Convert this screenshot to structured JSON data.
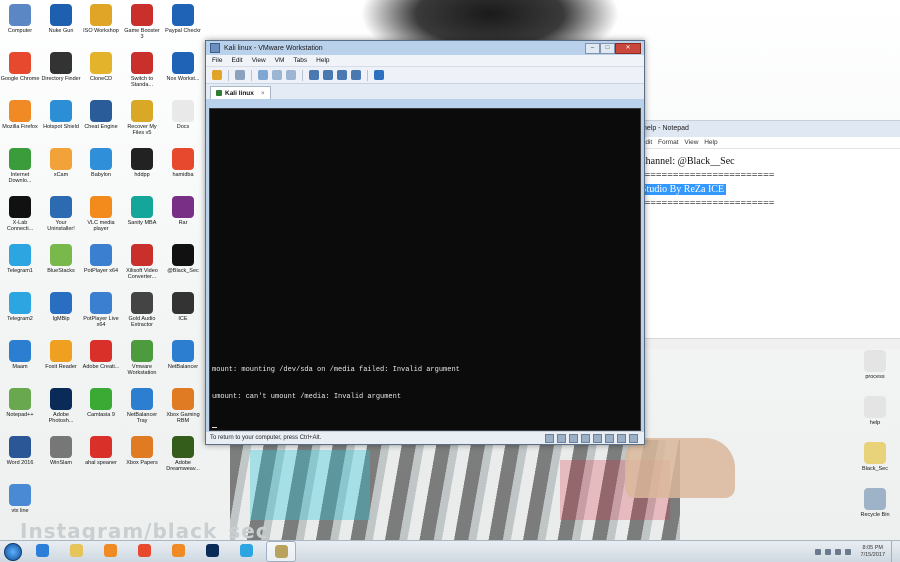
{
  "desktop": {
    "icons": [
      {
        "label": "Computer",
        "color": "#5b87c4"
      },
      {
        "label": "Nuke Gun",
        "color": "#1f5fb0"
      },
      {
        "label": "ISO Workshop",
        "color": "#e0a526"
      },
      {
        "label": "Game Booster 3",
        "color": "#c9302c"
      },
      {
        "label": "Paypal Checkr",
        "color": "#1e63b6"
      },
      {
        "label": "Google Chrome",
        "color": "#e7492f"
      },
      {
        "label": "Directory Finder",
        "color": "#333333"
      },
      {
        "label": "CloneCD",
        "color": "#e3b32b"
      },
      {
        "label": "Switch to Standa...",
        "color": "#c9302c"
      },
      {
        "label": "Nox Workst...",
        "color": "#1e63b6"
      },
      {
        "label": "Mozilla Firefox",
        "color": "#f08a24"
      },
      {
        "label": "Hotspot Shield",
        "color": "#2c8fd6"
      },
      {
        "label": "Cheat Engine",
        "color": "#2a5c9a"
      },
      {
        "label": "Recover My Files v5",
        "color": "#d9a826"
      },
      {
        "label": "Docs",
        "color": "#e9e9e9"
      },
      {
        "label": "Internet Downlo...",
        "color": "#3b9c3b"
      },
      {
        "label": "xCam",
        "color": "#f1a33a"
      },
      {
        "label": "Babylon",
        "color": "#2f8fd9"
      },
      {
        "label": "hddpp",
        "color": "#222222"
      },
      {
        "label": "hamidba",
        "color": "#e7492f"
      },
      {
        "label": "X-Lab Connecti...",
        "color": "#111111"
      },
      {
        "label": "Your Uninstaller!",
        "color": "#2c6ab2"
      },
      {
        "label": "VLC media player",
        "color": "#f28a1c"
      },
      {
        "label": "Sanity MBA",
        "color": "#15a69a"
      },
      {
        "label": "Rar",
        "color": "#7a2f86"
      },
      {
        "label": "Telegram1",
        "color": "#2ca5e0"
      },
      {
        "label": "BlueStacks",
        "color": "#79b84a"
      },
      {
        "label": "PotPlayer x64",
        "color": "#3b7fd0"
      },
      {
        "label": "Xilisoft Video Converter...",
        "color": "#c9302c"
      },
      {
        "label": "@Black_Sec",
        "color": "#111111"
      },
      {
        "label": "Telegram2",
        "color": "#2ca5e0"
      },
      {
        "label": "IgMBip",
        "color": "#2a6ec2"
      },
      {
        "label": "PotPlayer Live x64",
        "color": "#3b7fd0"
      },
      {
        "label": "Gold Audio Extractor",
        "color": "#444444"
      },
      {
        "label": "ICE",
        "color": "#333333"
      },
      {
        "label": "Maam",
        "color": "#2c7fd0"
      },
      {
        "label": "Foxit Reader",
        "color": "#f0a020"
      },
      {
        "label": "Adobe Creati...",
        "color": "#d9302a"
      },
      {
        "label": "Vmware Workstation",
        "color": "#4e9a3e"
      },
      {
        "label": "NetBalancer",
        "color": "#2c7fd0"
      },
      {
        "label": "Notepad++",
        "color": "#6aa84f"
      },
      {
        "label": "Adobe Photosh...",
        "color": "#0a2a57"
      },
      {
        "label": "Camtasia 9",
        "color": "#3aaa35"
      },
      {
        "label": "NetBalancer Tray",
        "color": "#2c7fd0"
      },
      {
        "label": "Xbox Gaming RBM",
        "color": "#e07b24"
      },
      {
        "label": "Word 2016",
        "color": "#2b5797"
      },
      {
        "label": "WinSlam",
        "color": "#777777"
      },
      {
        "label": "ahal speaner",
        "color": "#d9302a"
      },
      {
        "label": "Xbox Papers",
        "color": "#e07b24"
      },
      {
        "label": "Adobe Dreamweav...",
        "color": "#345d1c"
      },
      {
        "label": "vtx line",
        "color": "#4a8ad4"
      }
    ],
    "right_icons": [
      {
        "label": "process",
        "color": "#e4e4e4"
      },
      {
        "label": "help",
        "color": "#e4e4e4"
      },
      {
        "label": "Black_Sec",
        "color": "#e8d27a"
      },
      {
        "label": "Recycle Bin",
        "color": "#9fb3c8"
      }
    ],
    "watermark": "Instagram/black_sec"
  },
  "notepad": {
    "title": "help - Notepad",
    "menu": [
      "Edit",
      "Format",
      "View",
      "Help"
    ],
    "lines": [
      "Channel: @Black__Sec",
      "========================",
      "Studio By ReZa ICE",
      "========================"
    ]
  },
  "vmware": {
    "title": "Kali linux - VMware Workstation",
    "controls": {
      "min": "–",
      "max": "□",
      "close": "✕"
    },
    "menu": [
      "File",
      "Edit",
      "View",
      "VM",
      "Tabs",
      "Help"
    ],
    "tab_label": "Kali linux",
    "tab_close": "×",
    "terminal_lines": [
      "mount: mounting /dev/sda on /media failed: Invalid argument",
      "umount: can't umount /media: Invalid argument"
    ],
    "status_message": "To return to your computer, press Ctrl+Alt."
  },
  "taskbar": {
    "clock_time": "8:05 PM",
    "clock_date": "7/15/2017",
    "apps": [
      {
        "name": "internet-explorer",
        "color": "#2b7fd8"
      },
      {
        "name": "file-explorer",
        "color": "#e7c45a"
      },
      {
        "name": "media-player",
        "color": "#f08a24"
      },
      {
        "name": "chrome",
        "color": "#e7492f"
      },
      {
        "name": "firefox",
        "color": "#f08a24"
      },
      {
        "name": "photoshop",
        "color": "#0a2a57"
      },
      {
        "name": "telegram",
        "color": "#2ca5e0"
      },
      {
        "name": "vmware",
        "color": "#b9a25e"
      }
    ]
  }
}
